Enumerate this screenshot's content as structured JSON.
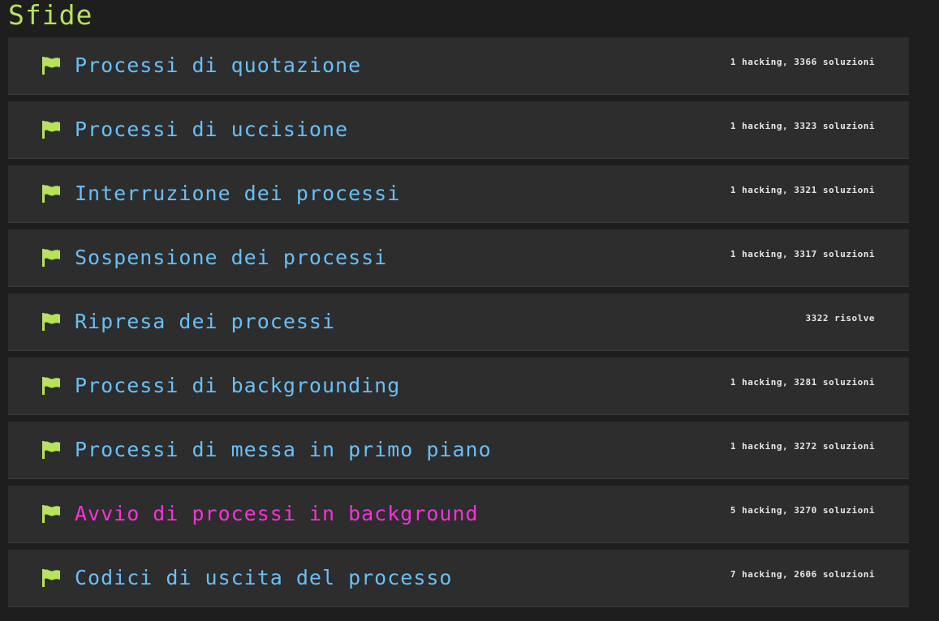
{
  "title": "Sfide",
  "colors": {
    "accent_green": "#b6e35d",
    "link_blue": "#69bff5",
    "active_magenta": "#f233d8",
    "row_bg": "#2d2d2d",
    "page_bg": "#1e1e1e"
  },
  "challenges": [
    {
      "title": "Processi di quotazione",
      "stats": "1 hacking, 3366 soluzioni",
      "icon": "flag-icon",
      "active": false
    },
    {
      "title": "Processi di uccisione",
      "stats": "1 hacking, 3323 soluzioni",
      "icon": "flag-icon",
      "active": false
    },
    {
      "title": "Interruzione dei processi",
      "stats": "1 hacking, 3321 soluzioni",
      "icon": "flag-icon",
      "active": false
    },
    {
      "title": "Sospensione dei processi",
      "stats": "1 hacking, 3317 soluzioni",
      "icon": "flag-icon",
      "active": false
    },
    {
      "title": "Ripresa dei processi",
      "stats": "3322 risolve",
      "icon": "flag-icon",
      "active": false
    },
    {
      "title": "Processi di backgrounding",
      "stats": "1 hacking, 3281 soluzioni",
      "icon": "flag-icon",
      "active": false
    },
    {
      "title": "Processi di messa in primo piano",
      "stats": "1 hacking, 3272 soluzioni",
      "icon": "flag-icon",
      "active": false
    },
    {
      "title": "Avvio di processi in background",
      "stats": "5 hacking, 3270 soluzioni",
      "icon": "flag-icon",
      "active": true
    },
    {
      "title": "Codici di uscita del processo",
      "stats": "7 hacking, 2606 soluzioni",
      "icon": "flag-icon",
      "active": false
    }
  ]
}
